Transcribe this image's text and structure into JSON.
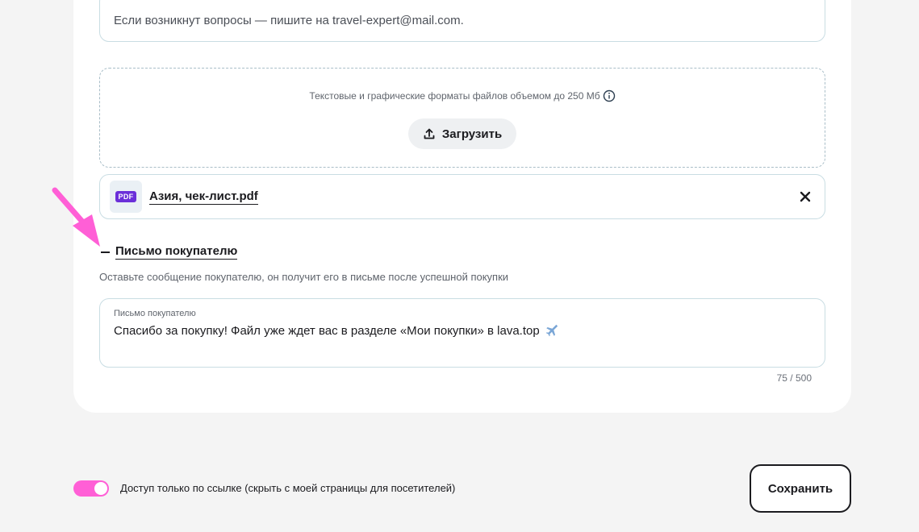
{
  "contact": {
    "text": "Если возникнут вопросы — пишите на travel-expert@mail.com."
  },
  "upload": {
    "hint": "Текстовые и графические форматы файлов объемом до 250 Мб",
    "button_label": "Загрузить",
    "icons": {
      "info": "info-icon",
      "upload": "upload-icon"
    }
  },
  "file": {
    "badge": "PDF",
    "name": "Азия, чек-лист.pdf",
    "remove_icon": "close-icon"
  },
  "letter_section": {
    "title": "Письмо покупателю",
    "description": "Оставьте сообщение покупателю, он получит его в письме после успешной покупки",
    "field_label": "Письмо покупателю",
    "field_value": "Спасибо за покупку! Файл уже ждет вас в разделе «Мои покупки» в lava.top",
    "counter": "75 / 500",
    "toggle_icon": "minus-icon"
  },
  "visibility": {
    "enabled": true,
    "label": "Доступ только по ссылке (скрыть с моей страницы для посетителей)"
  },
  "actions": {
    "save_label": "Сохранить"
  },
  "colors": {
    "accent_pink": "#ff5fd6",
    "pdf_badge": "#6b2fd9",
    "border": "#c9dde3",
    "background": "#f4f4f4"
  }
}
